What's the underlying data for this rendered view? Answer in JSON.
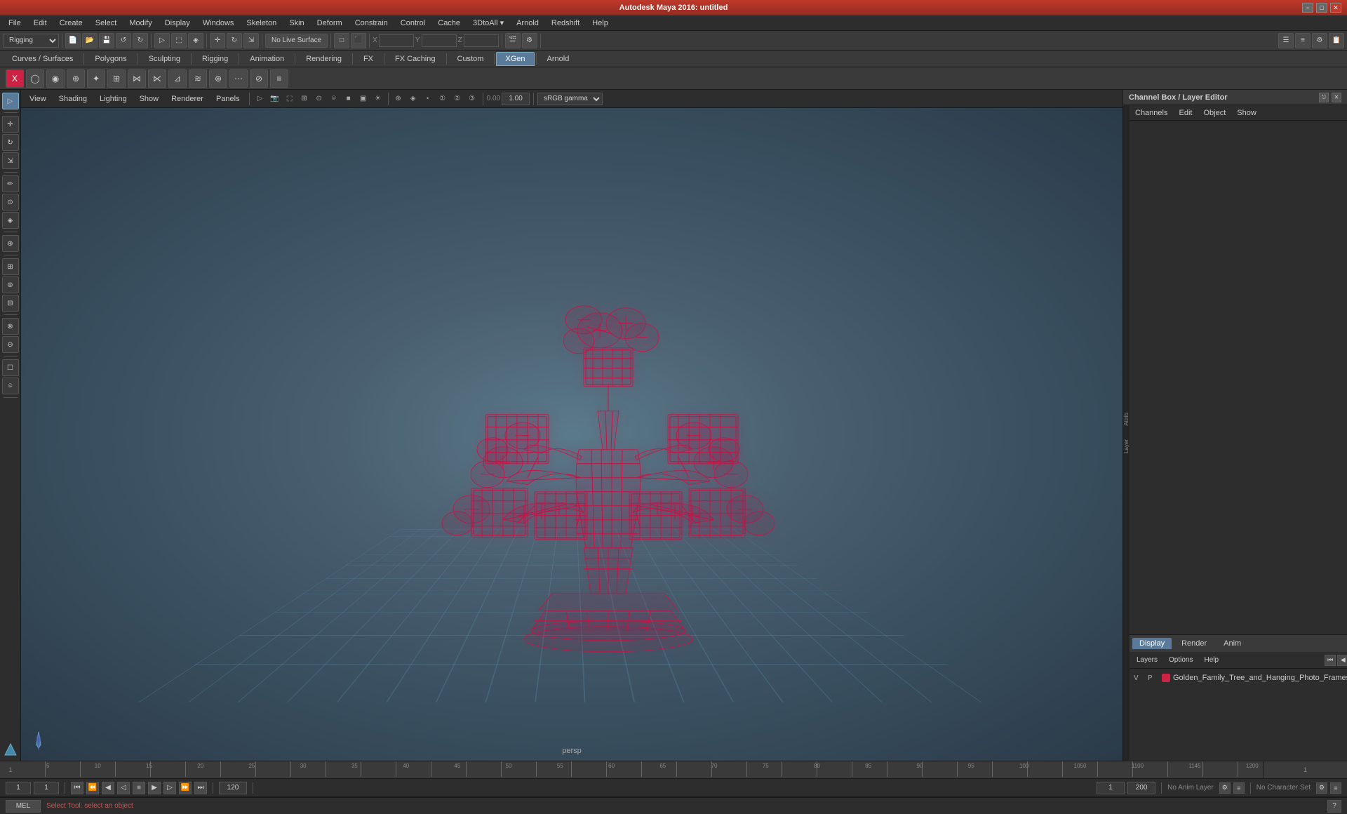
{
  "titlebar": {
    "title": "Autodesk Maya 2016: untitled",
    "minimize": "−",
    "maximize": "□",
    "close": "✕"
  },
  "menubar": {
    "items": [
      "File",
      "Edit",
      "Create",
      "Select",
      "Modify",
      "Display",
      "Windows",
      "Skeleton",
      "Skin",
      "Deform",
      "Constrain",
      "Control",
      "Cache",
      "3DtoAll ▾",
      "Arnold",
      "Redshift",
      "Help"
    ]
  },
  "tabs": {
    "items": [
      "Curves / Surfaces",
      "Polygons",
      "Sculpting",
      "Rigging",
      "Animation",
      "Rendering",
      "FX",
      "FX Caching",
      "Custom",
      "XGen",
      "Arnold"
    ]
  },
  "toolbar": {
    "mode": "Rigging",
    "live_surface": "No Live Surface"
  },
  "viewport": {
    "menus": [
      "View",
      "Shading",
      "Lighting",
      "Show",
      "Renderer",
      "Panels"
    ],
    "label": "persp",
    "gamma": "sRGB gamma"
  },
  "channel_box": {
    "title": "Channel Box / Layer Editor",
    "tabs": [
      "Channels",
      "Edit",
      "Object",
      "Show"
    ]
  },
  "layer_editor": {
    "tabs": [
      "Display",
      "Render",
      "Anim"
    ],
    "controls": [
      "Layers",
      "Options",
      "Help"
    ],
    "layers": [
      {
        "visible": "V",
        "playable": "P",
        "color": "#cc2244",
        "name": "Golden_Family_Tree_and_Hanging_Photo_Frames_mb_st"
      }
    ]
  },
  "playback": {
    "current_frame": "1",
    "start_frame": "1",
    "end_frame": "120",
    "range_start": "1",
    "range_end": "120",
    "fps": "200",
    "anim_layer": "No Anim Layer",
    "char_set": "No Character Set"
  },
  "status_bar": {
    "mode": "MEL",
    "message": "Select Tool: select an object"
  },
  "coordinates": {
    "x_label": "X",
    "y_label": "Y",
    "z_label": "Z",
    "x_val": "",
    "y_val": "",
    "z_val": ""
  },
  "timeline": {
    "ticks": [
      "5",
      "10",
      "15",
      "20",
      "25",
      "30",
      "35",
      "40",
      "45",
      "50",
      "55",
      "60",
      "65",
      "70",
      "75",
      "80",
      "85",
      "90",
      "95",
      "100",
      "1050",
      "1100",
      "1145",
      "1200"
    ]
  }
}
